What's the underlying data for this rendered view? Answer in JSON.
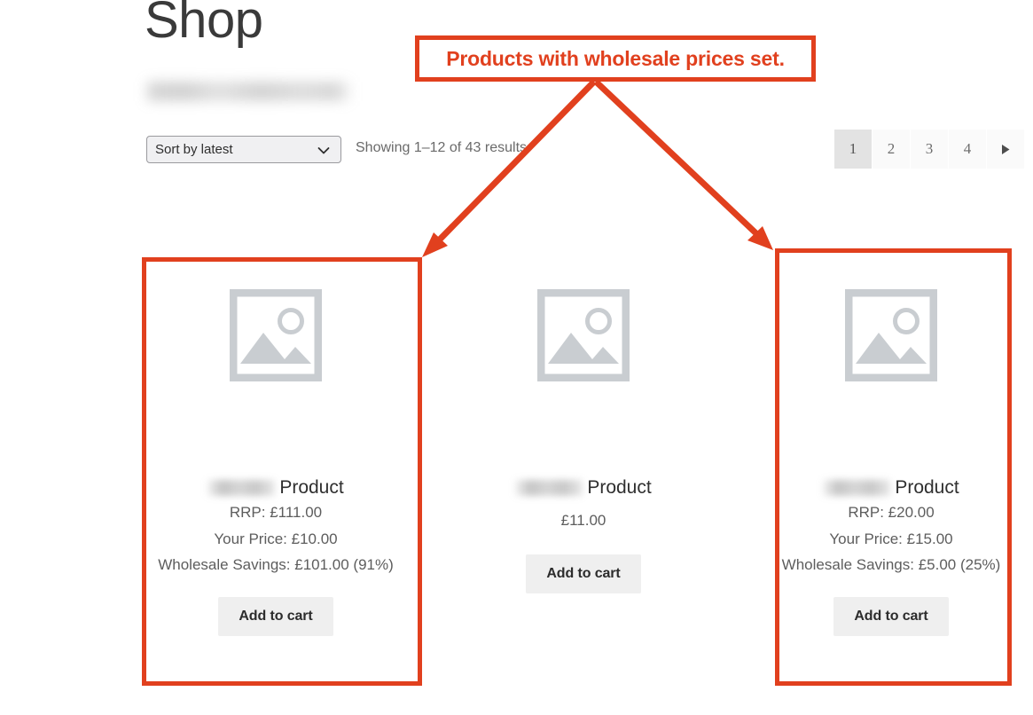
{
  "page": {
    "title": "Shop",
    "redacted_subtitle": ""
  },
  "toolbar": {
    "sort_selected": "Sort by latest",
    "sort_options": [
      "Sort by latest"
    ],
    "result_count": "Showing 1–12 of 43 results",
    "chevron_icon": "chevron-down-icon"
  },
  "pagination": {
    "pages": [
      "1",
      "2",
      "3",
      "4"
    ],
    "active": "1",
    "next_icon": "next-page-arrow-icon"
  },
  "products": [
    {
      "thumb_icon": "image-placeholder-icon",
      "title_suffix": "Product",
      "has_wholesale": true,
      "rrp": "RRP: £111.00",
      "your_price": "Your Price: £10.00",
      "savings": "Wholesale Savings: £101.00 (91%)",
      "price": "",
      "add_to_cart": "Add to cart"
    },
    {
      "thumb_icon": "image-placeholder-icon",
      "title_suffix": "Product",
      "has_wholesale": false,
      "rrp": "",
      "your_price": "",
      "savings": "",
      "price": "£11.00",
      "add_to_cart": "Add to cart"
    },
    {
      "thumb_icon": "image-placeholder-icon",
      "title_suffix": "Product",
      "has_wholesale": true,
      "rrp": "RRP: £20.00",
      "your_price": "Your Price: £15.00",
      "savings": "Wholesale Savings: £5.00 (25%)",
      "price": "",
      "add_to_cart": "Add to cart"
    }
  ],
  "annotation": {
    "callout_text": "Products with wholesale prices set.",
    "color": "#e1401e",
    "arrow_left_icon": "annotation-arrow-icon",
    "arrow_right_icon": "annotation-arrow-icon"
  },
  "colors": {
    "annotation_red": "#e1401e",
    "button_bg": "#efefef",
    "pagination_active_bg": "#e3e3e3",
    "placeholder_gray": "#c9cdd1"
  }
}
